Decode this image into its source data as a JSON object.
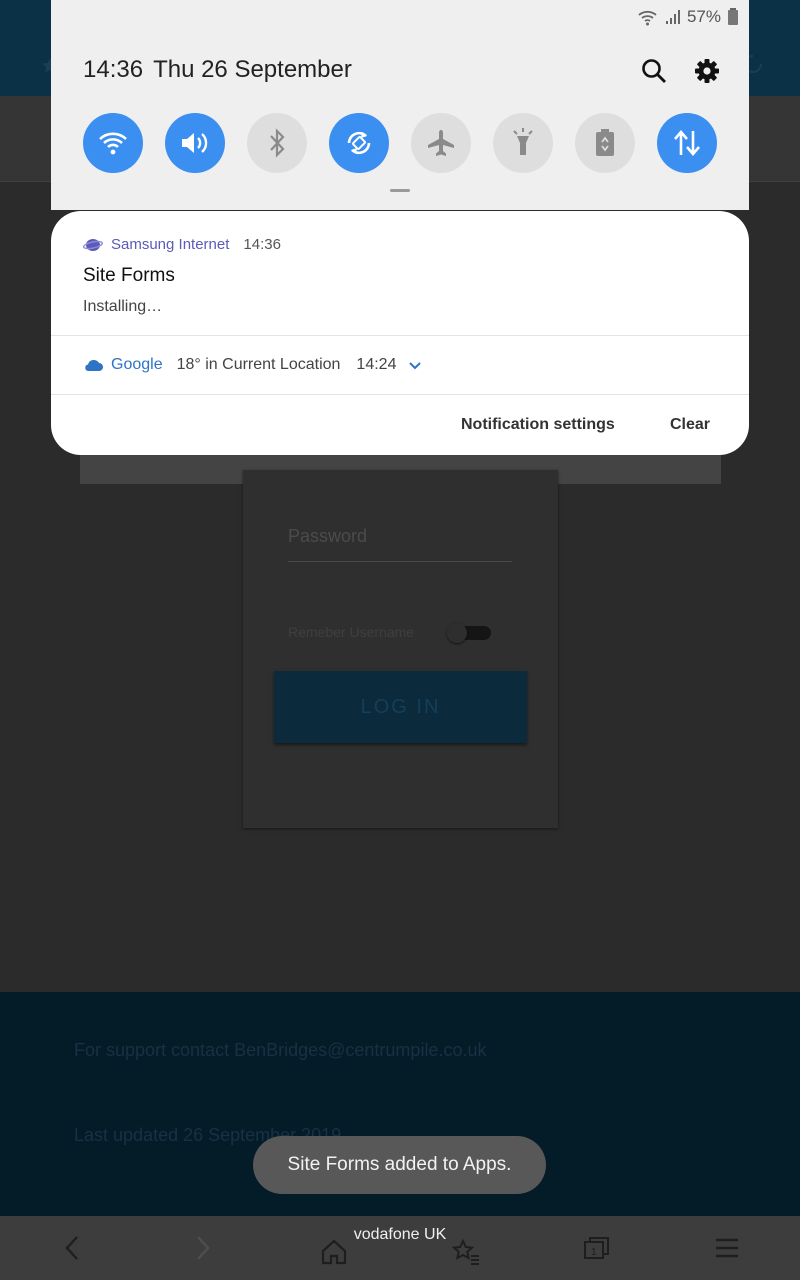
{
  "status_bar": {
    "battery": "57%"
  },
  "shade": {
    "time": "14:36",
    "date": "Thu 26 September",
    "quick_settings": [
      {
        "name": "wifi",
        "icon": "wifi-icon",
        "active": true
      },
      {
        "name": "sound",
        "icon": "speaker-icon",
        "active": true
      },
      {
        "name": "bluetooth",
        "icon": "bluetooth-icon",
        "active": false
      },
      {
        "name": "auto-rotate",
        "icon": "rotate-icon",
        "active": true
      },
      {
        "name": "airplane-mode",
        "icon": "airplane-icon",
        "active": false
      },
      {
        "name": "flashlight",
        "icon": "flashlight-icon",
        "active": false
      },
      {
        "name": "power-saving",
        "icon": "battery-recycle-icon",
        "active": false
      },
      {
        "name": "mobile-data",
        "icon": "data-arrows-icon",
        "active": true
      }
    ]
  },
  "notifications": {
    "samsung": {
      "app": "Samsung Internet",
      "time": "14:36",
      "title": "Site Forms",
      "body": "Installing…"
    },
    "google": {
      "app": "Google",
      "text": "18° in Current Location",
      "time": "14:24"
    },
    "settings_label": "Notification settings",
    "clear_label": "Clear"
  },
  "page": {
    "password_placeholder": "Password",
    "remember_label": "Remeber Username",
    "login_label": "LOG IN",
    "support_text": "For support contact BenBridges@centrumpile.co.uk",
    "updated_text": "Last updated 26 September 2019"
  },
  "toast": "Site Forms added to Apps.",
  "browser": {
    "carrier": "vodafone UK"
  },
  "colors": {
    "accent": "#3b8ff0",
    "header": "#0b3147",
    "footer": "#041b28"
  }
}
